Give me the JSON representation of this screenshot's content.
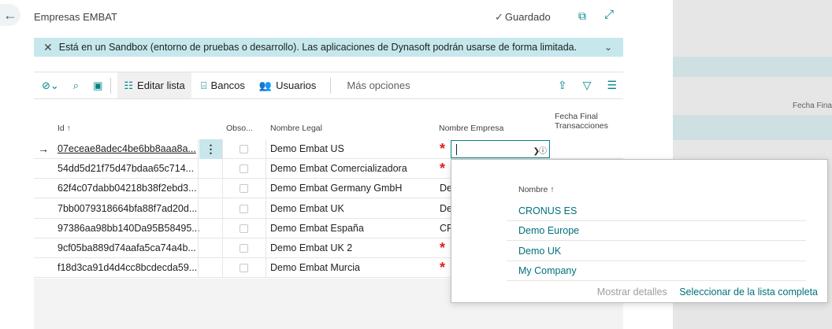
{
  "header": {
    "title": "Empresas EMBAT",
    "saved": "Guardado",
    "saved_icon": "check-icon",
    "back_icon": "arrow-left-icon"
  },
  "banner": {
    "text": "Está en un Sandbox (entorno de pruebas o desarrollo). Las aplicaciones de Dynasoft podrán usarse de forma limitada.",
    "color": "#c6e8ec"
  },
  "toolbar": {
    "edit_list": "Editar lista",
    "banks": "Bancos",
    "users": "Usuarios",
    "more": "Más opciones"
  },
  "table": {
    "headers": {
      "id": "Id ↑",
      "obso": "Obso...",
      "legal": "Nombre Legal",
      "empresa": "Nombre Empresa",
      "fecha1": "Fecha Final",
      "fecha2": "Transacciones"
    },
    "rows": [
      {
        "id": "07eceae8adec4be6bb8aaa8a...",
        "legal": "Demo Embat US",
        "empresa": "*"
      },
      {
        "id": "54dd5d21f75d47bdaa65c714...",
        "legal": "Demo Embat Comercializadora",
        "empresa": "*"
      },
      {
        "id": "62f4c07dabb04218b38f2ebd3...",
        "legal": "Demo Embat Germany GmbH",
        "empresa": "De"
      },
      {
        "id": "7bb0079318664bfa88f7ad20d...",
        "legal": "Demo Embat UK",
        "empresa": "De"
      },
      {
        "id": "97386aa98bb140Da95B58495...",
        "legal": "Demo Embat España",
        "empresa": "CR"
      },
      {
        "id": "9cf05ba889d74aafa5ca74a4b...",
        "legal": "Demo Embat UK 2",
        "empresa": "*"
      },
      {
        "id": "f18d3ca91d4d4cc8bcdecda59...",
        "legal": "Demo Embat Murcia",
        "empresa": "*"
      }
    ]
  },
  "background_panel": {
    "label": "Fecha Fina"
  },
  "dropdown": {
    "header": "Nombre ↑",
    "items": [
      "CRONUS ES",
      "Demo Europe",
      "Demo UK",
      "My Company"
    ],
    "show_details": "Mostrar detalles",
    "select_full": "Seleccionar de la lista completa"
  },
  "colors": {
    "accent": "#008489",
    "required": "#e01f1f",
    "selection": "#c9e6ea"
  }
}
